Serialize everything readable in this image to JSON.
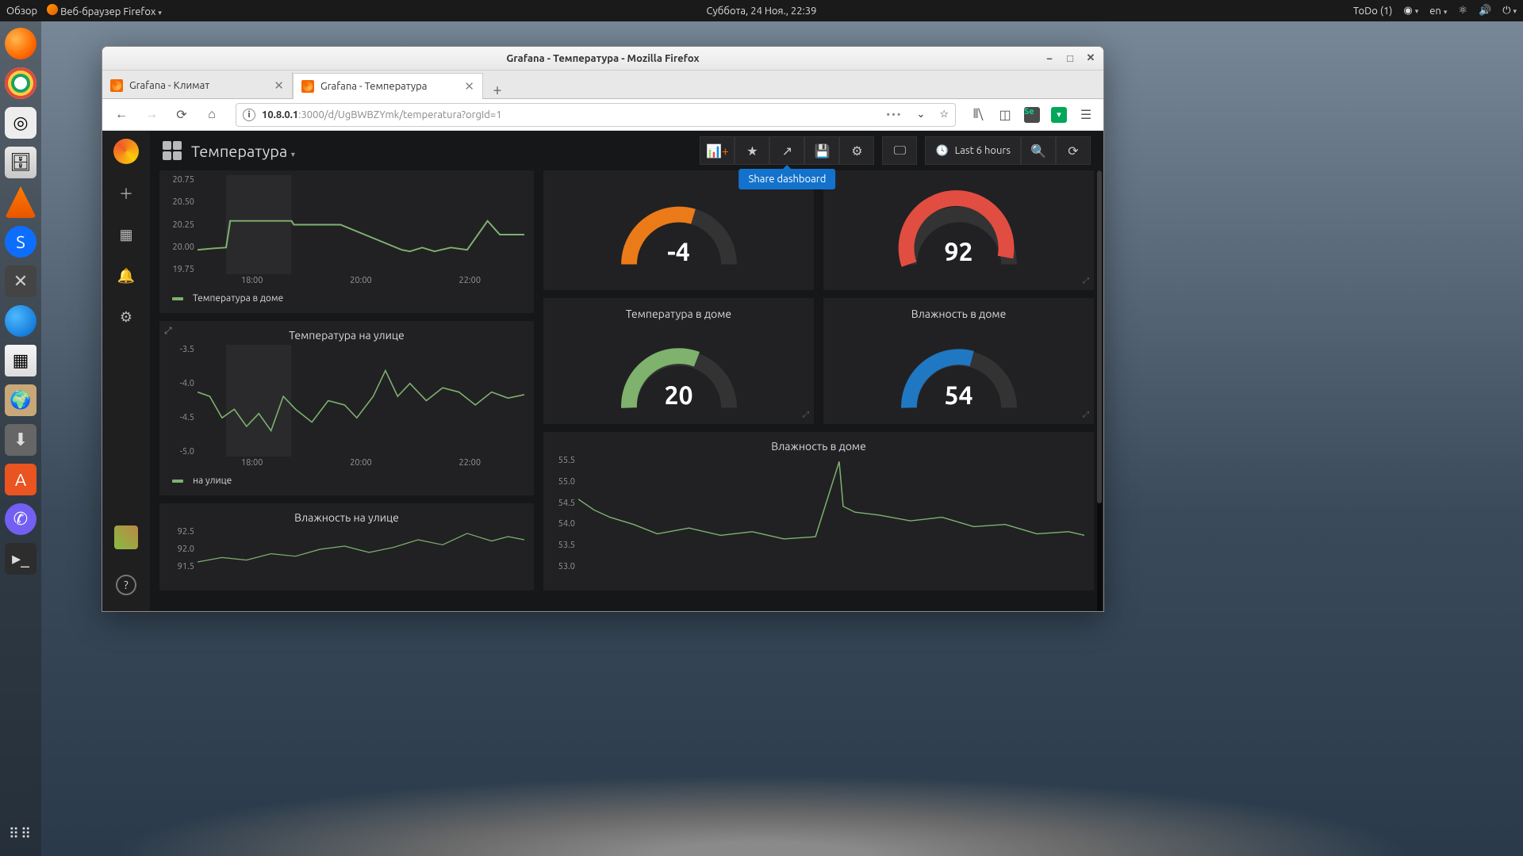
{
  "topbar": {
    "overview": "Обзор",
    "app": "Веб-браузер Firefox",
    "clock": "Суббота, 24 Ноя., 22:39",
    "todo": "ToDo (1)",
    "lang": "en"
  },
  "window": {
    "title": "Grafana - Температура - Mozilla Firefox"
  },
  "tabs": [
    {
      "label": "Grafana - Климат",
      "active": false
    },
    {
      "label": "Grafana - Температура",
      "active": true
    }
  ],
  "url": {
    "host": "10.8.0.1",
    "path": ":3000/d/UgBWBZYmk/temperatura?orgId=1"
  },
  "grafana": {
    "dashboard_title": "Температура",
    "time_range": "Last 6 hours",
    "tooltip": "Share dashboard"
  },
  "gauges": {
    "outside_temp": {
      "value": "-4",
      "color": "#eb7b18"
    },
    "outside_humidity": {
      "value": "92",
      "color": "#e24d42"
    },
    "inside_temp_title": "Температура в доме",
    "inside_temp": {
      "value": "20",
      "color": "#7eb26d"
    },
    "inside_humidity_title": "Влажность в доме",
    "inside_humidity": {
      "value": "54",
      "color": "#1f78c1"
    }
  },
  "charts": {
    "home_temp": {
      "legend": "Температура в доме",
      "yticks": [
        "20.75",
        "20.50",
        "20.25",
        "20.00",
        "19.75"
      ],
      "xticks": [
        "18:00",
        "20:00",
        "22:00"
      ]
    },
    "outside_temp": {
      "title": "Температура на улице",
      "legend": "на улице",
      "yticks": [
        "-3.5",
        "-4.0",
        "-4.5",
        "-5.0"
      ],
      "xticks": [
        "18:00",
        "20:00",
        "22:00"
      ]
    },
    "outside_hum": {
      "title": "Влажность на улице",
      "yticks": [
        "92.5",
        "92.0",
        "91.5"
      ]
    },
    "home_hum": {
      "title": "Влажность в доме",
      "yticks": [
        "55.5",
        "55.0",
        "54.5",
        "54.0",
        "53.5",
        "53.0"
      ]
    }
  },
  "chart_data": [
    {
      "type": "line",
      "title": "Температура в доме",
      "ylim": [
        19.75,
        20.75
      ],
      "xticks": [
        "18:00",
        "20:00",
        "22:00"
      ],
      "series": [
        {
          "name": "Температура в доме",
          "values": [
            20.0,
            20.05,
            20.3,
            20.3,
            20.3,
            20.25,
            null,
            null,
            20.0,
            20.0,
            20.05,
            20.0,
            20.05,
            20.0,
            20.3,
            20.15,
            20.15
          ]
        }
      ]
    },
    {
      "type": "line",
      "title": "Температура на улице",
      "ylim": [
        -5.0,
        -3.5
      ],
      "xticks": [
        "18:00",
        "20:00",
        "22:00"
      ],
      "series": [
        {
          "name": "на улице",
          "values": [
            -4.2,
            -4.3,
            -4.6,
            -4.5,
            -4.7,
            -4.5,
            -4.7,
            -4.4,
            -4.5,
            -4.6,
            -4.3,
            -4.0,
            -4.3,
            -4.1,
            -4.3,
            -4.2,
            -4.3
          ]
        }
      ]
    },
    {
      "type": "line",
      "title": "Влажность на улице",
      "ylim": [
        91.0,
        92.5
      ],
      "series": [
        {
          "name": "",
          "values": [
            91.2,
            91.4,
            91.3,
            91.6,
            91.5,
            91.8,
            91.9,
            91.6,
            91.8,
            92.0,
            92.2,
            91.9,
            92.1,
            92.3,
            92.0,
            92.2,
            92.1
          ]
        }
      ]
    },
    {
      "type": "line",
      "title": "Влажность в доме",
      "ylim": [
        53.0,
        55.5
      ],
      "series": [
        {
          "name": "",
          "values": [
            54.3,
            53.9,
            53.7,
            53.6,
            53.4,
            53.5,
            53.3,
            53.4,
            53.3,
            55.3,
            54.0,
            53.9,
            53.8,
            53.6,
            53.7,
            53.5,
            53.4
          ]
        }
      ]
    },
    {
      "type": "gauge",
      "title": "Температура на улице",
      "value": -4
    },
    {
      "type": "gauge",
      "title": "Влажность на улице",
      "value": 92
    },
    {
      "type": "gauge",
      "title": "Температура в доме",
      "value": 20
    },
    {
      "type": "gauge",
      "title": "Влажность в доме",
      "value": 54
    }
  ]
}
